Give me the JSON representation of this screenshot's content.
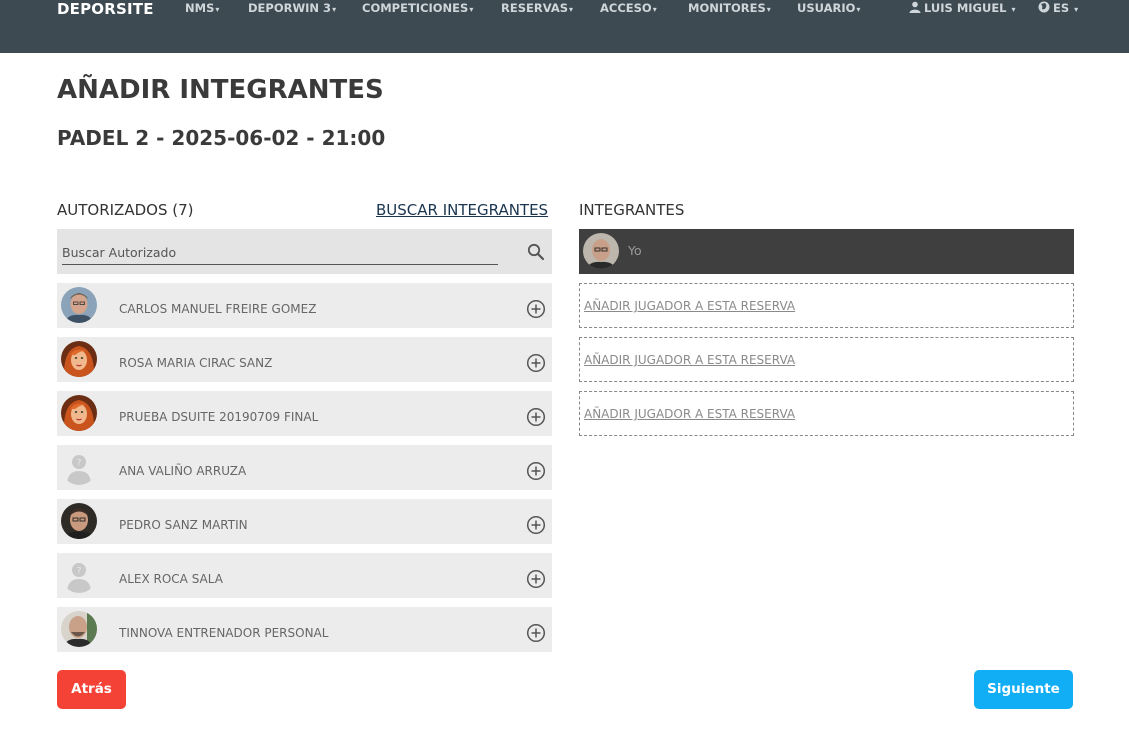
{
  "navbar": {
    "brand": "DEPORSITE",
    "items": [
      {
        "label": "NMS"
      },
      {
        "label": "DEPORWIN 3"
      },
      {
        "label": "COMPETICIONES"
      },
      {
        "label": "RESERVAS"
      },
      {
        "label": "ACCESO"
      },
      {
        "label": "MONITORES"
      },
      {
        "label": "USUARIO"
      }
    ],
    "user": {
      "label": "LUIS MIGUEL",
      "icon": "user-icon"
    },
    "language": {
      "label": "ES",
      "icon": "globe-icon"
    },
    "caret": "▾"
  },
  "page": {
    "title": "AÑADIR INTEGRANTES",
    "subtitle": "PADEL 2 - 2025-06-02 - 21:00"
  },
  "authorized": {
    "label": "AUTORIZADOS (7)",
    "search_link": "BUSCAR INTEGRANTES",
    "search_placeholder": "Buscar Autorizado",
    "search_icon": "search-icon",
    "add_icon": "add-circle-icon",
    "items": [
      {
        "name": "CARLOS MANUEL FREIRE GOMEZ",
        "avatar": "photo-man-1"
      },
      {
        "name": "ROSA MARIA CIRAC SANZ",
        "avatar": "illustrated-woman"
      },
      {
        "name": "PRUEBA DSUITE 20190709 FINAL",
        "avatar": "illustrated-woman"
      },
      {
        "name": "ANA VALIÑO ARRUZA",
        "avatar": "default-user"
      },
      {
        "name": "PEDRO SANZ MARTIN",
        "avatar": "photo-man-2"
      },
      {
        "name": "ALEX ROCA SALA",
        "avatar": "default-user"
      },
      {
        "name": "TINNOVA ENTRENADOR PERSONAL",
        "avatar": "photo-man-3"
      }
    ]
  },
  "members": {
    "label": "INTEGRANTES",
    "me": {
      "label": "Yo",
      "avatar": "photo-man-4"
    },
    "slots": [
      {
        "label": "AÑADIR JUGADOR A ESTA RESERVA"
      },
      {
        "label": "AÑADIR JUGADOR A ESTA RESERVA"
      },
      {
        "label": "AÑADIR JUGADOR A ESTA RESERVA"
      }
    ]
  },
  "buttons": {
    "back": "Atrás",
    "next": "Siguiente"
  },
  "colors": {
    "navbar": "#3d4a52",
    "back_button": "#f44336",
    "next_button": "#12aef5",
    "me_row": "#3f3f3f"
  }
}
